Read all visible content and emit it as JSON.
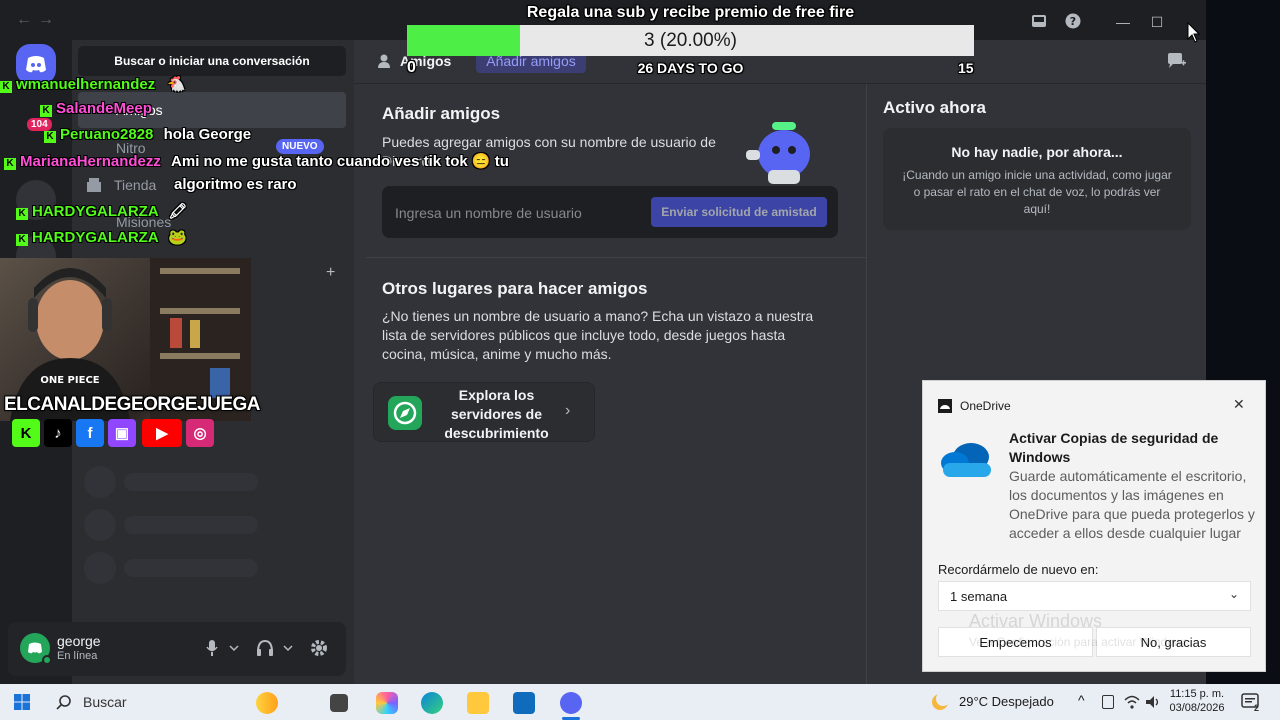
{
  "titlebar": {
    "back": "←",
    "forward": "→"
  },
  "stream_goal": {
    "title": "Regala una sub y recibe premio de free fire",
    "progress_text": "3 (20.00%)",
    "progress": 0.2,
    "days_left": "26 DAYS TO GO",
    "current": "0",
    "target": "15"
  },
  "sidebar": {
    "search_label": "Buscar o iniciar una conversación",
    "items": [
      {
        "label": "Amigos"
      },
      {
        "label": "Nitro"
      },
      {
        "label": "Tienda"
      },
      {
        "label": "Misiones"
      }
    ],
    "new_badge": "NUEVO",
    "add_dm": "+"
  },
  "user": {
    "name": "george",
    "status": "En línea"
  },
  "topbar": {
    "friends": "Amigos",
    "add_friend_tab": "Añadir amigos"
  },
  "add_friends": {
    "title": "Añadir amigos",
    "description": "Puedes agregar amigos con su nombre de usuario de Discord.",
    "placeholder": "Ingresa un nombre de usuario",
    "send_button": "Enviar solicitud de amistad"
  },
  "other_places": {
    "title": "Otros lugares para hacer amigos",
    "description": "¿No tienes un nombre de usuario a mano? Echa un vistazo a nuestra lista de servidores públicos que incluye todo, desde juegos hasta cocina, música, anime y mucho más.",
    "explore_label": "Explora los servidores de descubrimiento",
    "explore_chevron": "›"
  },
  "active_now": {
    "title": "Activo ahora",
    "empty_title": "No hay nadie, por ahora...",
    "empty_desc": "¡Cuando un amigo inicie una actividad, como jugar o pasar el rato en el chat de voz, lo podrás ver aquí!"
  },
  "chat": [
    {
      "name": "wmanuelhernandez",
      "name_color": "#53fc18",
      "message": "🐔"
    },
    {
      "name": "SalandeMeep",
      "name_color": "#ff4fd8",
      "message": ""
    },
    {
      "name": "Peruano2828",
      "name_color": "#53fc18",
      "message": "hola George"
    },
    {
      "name": "MarianaHernandezz",
      "name_color": "#ff4fd8",
      "message": "Ami no me gusta tanto cuando ves tik tok 😑 tu"
    },
    {
      "name": "",
      "name_color": "#ffffff",
      "message": "algoritmo es raro"
    },
    {
      "name": "HARDYGALARZA",
      "name_color": "#53fc18",
      "message": "🖍"
    },
    {
      "name": "HARDYGALARZA",
      "name_color": "#53fc18",
      "message": "🐸"
    }
  ],
  "chat_badge": "104",
  "streamer": {
    "channel": "ELCANALDEGEORGEJUEGA",
    "shirt_text": "ONE PIECE"
  },
  "socials": [
    {
      "name": "kick",
      "glyph": "K",
      "color": "#53fc18"
    },
    {
      "name": "tiktok",
      "glyph": "♪",
      "color": "#000000"
    },
    {
      "name": "facebook",
      "glyph": "f",
      "color": "#1877f2"
    },
    {
      "name": "twitch",
      "glyph": "▣",
      "color": "#9146ff"
    },
    {
      "name": "youtube",
      "glyph": "▶",
      "color": "#ff0000"
    },
    {
      "name": "instagram",
      "glyph": "◎",
      "color": "#d62976"
    }
  ],
  "onedrive": {
    "app_name": "OneDrive",
    "title": "Activar Copias de seguridad de Windows",
    "body": "Guarde automáticamente el escritorio, los documentos y las imágenes en OneDrive para que pueda protegerlos y acceder a ellos desde cualquier lugar",
    "remind_label": "Recordármelo de nuevo en:",
    "remind_value": "1 semana",
    "primary_button": "Empecemos",
    "secondary_button": "No, gracias",
    "watermark_title": "Activar Windows",
    "watermark_sub": "Ve a Configuración para activar Windows."
  },
  "taskbar": {
    "search_placeholder": "Buscar",
    "weather": "29°C  Despejado",
    "time": "11:15 p. m.",
    "date": "03/08/2026",
    "notification_count": "2"
  }
}
